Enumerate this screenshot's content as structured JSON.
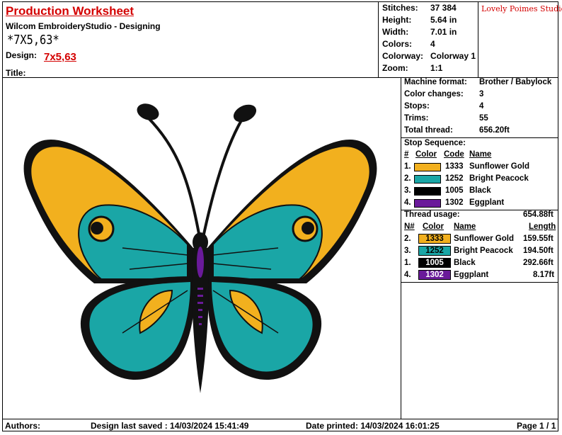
{
  "header": {
    "title": "Production Worksheet",
    "subtitle": "Wilcom EmbroideryStudio - Designing",
    "design_name": "*7X5,63*",
    "design_label": "Design:",
    "design_value": "7x5,63",
    "title_label": "Title:",
    "logo_text": "Lovely Poimes Studio"
  },
  "stats": [
    {
      "key": "Stitches:",
      "value": "37 384"
    },
    {
      "key": "Height:",
      "value": "5.64 in"
    },
    {
      "key": "Width:",
      "value": "7.01 in"
    },
    {
      "key": "Colors:",
      "value": "4"
    },
    {
      "key": "Colorway:",
      "value": "Colorway 1"
    },
    {
      "key": "Zoom:",
      "value": "1:1"
    }
  ],
  "machine": [
    {
      "key": "Machine format:",
      "value": "Brother / Babylock"
    },
    {
      "key": "Color changes:",
      "value": "3"
    },
    {
      "key": "Stops:",
      "value": "4"
    },
    {
      "key": "Trims:",
      "value": "55"
    },
    {
      "key": "Total thread:",
      "value": "656.20ft"
    }
  ],
  "stop_sequence": {
    "title": "Stop Sequence:",
    "headers": {
      "num": "#",
      "color": "Color",
      "code": "Code",
      "name": "Name"
    },
    "rows": [
      {
        "num": "1.",
        "code": "1333",
        "name": "Sunflower Gold",
        "hex": "#f2b01e"
      },
      {
        "num": "2.",
        "code": "1252",
        "name": "Bright Peacock",
        "hex": "#1aa6a6"
      },
      {
        "num": "3.",
        "code": "1005",
        "name": "Black",
        "hex": "#000000"
      },
      {
        "num": "4.",
        "code": "1302",
        "name": "Eggplant",
        "hex": "#6a1a9a"
      }
    ]
  },
  "thread_usage": {
    "title": "Thread usage:",
    "total": "654.88ft",
    "headers": {
      "num": "N#",
      "color": "Color",
      "name": "Name",
      "length": "Length"
    },
    "rows": [
      {
        "num": "2.",
        "code": "1333",
        "name": "Sunflower Gold",
        "length": "159.55ft",
        "hex": "#f2b01e",
        "text_color": "#000000"
      },
      {
        "num": "3.",
        "code": "1252",
        "name": "Bright Peacock",
        "length": "194.50ft",
        "hex": "#1aa6a6",
        "text_color": "#000000"
      },
      {
        "num": "1.",
        "code": "1005",
        "name": "Black",
        "length": "292.66ft",
        "hex": "#000000",
        "text_color": "#ffffff"
      },
      {
        "num": "4.",
        "code": "1302",
        "name": "Eggplant",
        "length": "8.17ft",
        "hex": "#6a1a9a",
        "text_color": "#ffffff"
      }
    ]
  },
  "footer": {
    "authors": "Authors:",
    "saved": "Design last saved : 14/03/2024 15:41:49",
    "printed": "Date printed: 14/03/2024 16:01:25",
    "page": "Page 1 / 1"
  },
  "colors": {
    "accent_red": "#d40000",
    "gold": "#f2b01e",
    "teal": "#1aa6a6",
    "black": "#000000",
    "eggplant": "#6a1a9a"
  }
}
